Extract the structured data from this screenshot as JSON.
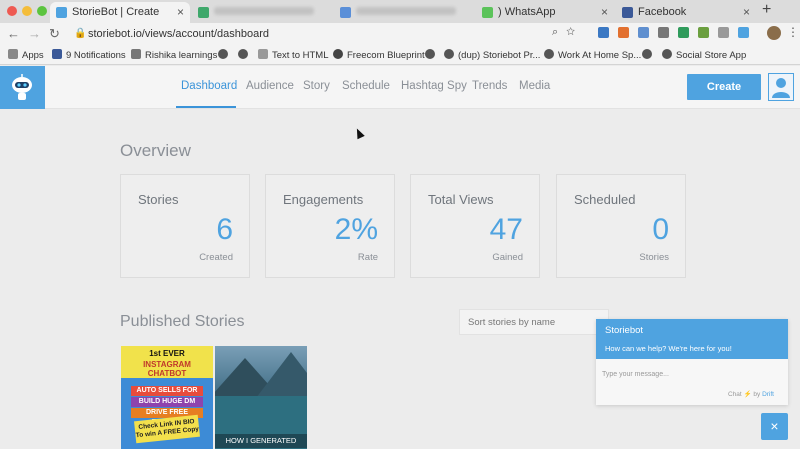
{
  "browser": {
    "tabs": [
      {
        "title": "StorieBot | Create",
        "active": true
      },
      {
        "title": "",
        "active": false
      },
      {
        "title": "",
        "active": false
      },
      {
        "title": ") WhatsApp",
        "active": false
      },
      {
        "title": "Facebook",
        "active": false
      }
    ],
    "url": "storiebot.io/views/account/dashboard",
    "bookmarks": [
      {
        "label": "Apps",
        "icon": "apps-grid-icon"
      },
      {
        "label": "9 Notifications",
        "icon": "facebook-icon"
      },
      {
        "label": "Rishika learnings",
        "icon": "folder-icon"
      },
      {
        "label": "Text to HTML",
        "icon": "page-icon"
      },
      {
        "label": "Freecom Blueprint",
        "icon": "apple-icon"
      },
      {
        "label": "(dup) Storiebot Pr...",
        "icon": "globe-icon"
      },
      {
        "label": "Work At Home Sp...",
        "icon": "globe-icon"
      },
      {
        "label": "Social Store App",
        "icon": "globe-icon"
      }
    ]
  },
  "nav": {
    "items": [
      "Dashboard",
      "Audience",
      "Story",
      "Schedule",
      "Hashtag Spy",
      "Trends",
      "Media"
    ],
    "active": "Dashboard",
    "create_label": "Create"
  },
  "overview": {
    "title": "Overview",
    "cards": [
      {
        "title": "Stories",
        "value": "6",
        "sub": "Created"
      },
      {
        "title": "Engagements",
        "value": "2%",
        "sub": "Rate"
      },
      {
        "title": "Total Views",
        "value": "47",
        "sub": "Gained"
      },
      {
        "title": "Scheduled",
        "value": "0",
        "sub": "Stories"
      }
    ]
  },
  "published": {
    "title": "Published Stories",
    "sort_placeholder": "Sort stories by name",
    "stories": [
      {
        "head_lines": [
          "1st EVER",
          "INSTAGRAM CHATBOT"
        ],
        "bands": [
          "AUTO SELLS FOR YOU",
          "BUILD HUGE DM LIST",
          "DRIVE FREE TRAFFIC"
        ],
        "sign": "Check Link IN BIO To win A FREE Copy"
      },
      {
        "caption": "HOW I GENERATED"
      }
    ]
  },
  "chat": {
    "title": "Storiebot",
    "subtitle": "How can we help? We're here for you!",
    "input_placeholder": "Type your message...",
    "footer_prefix": "Chat",
    "footer_by": "by",
    "footer_brand": "Drift",
    "close": "×"
  },
  "colors": {
    "accent": "#4fa3e0",
    "background": "#ececec"
  }
}
